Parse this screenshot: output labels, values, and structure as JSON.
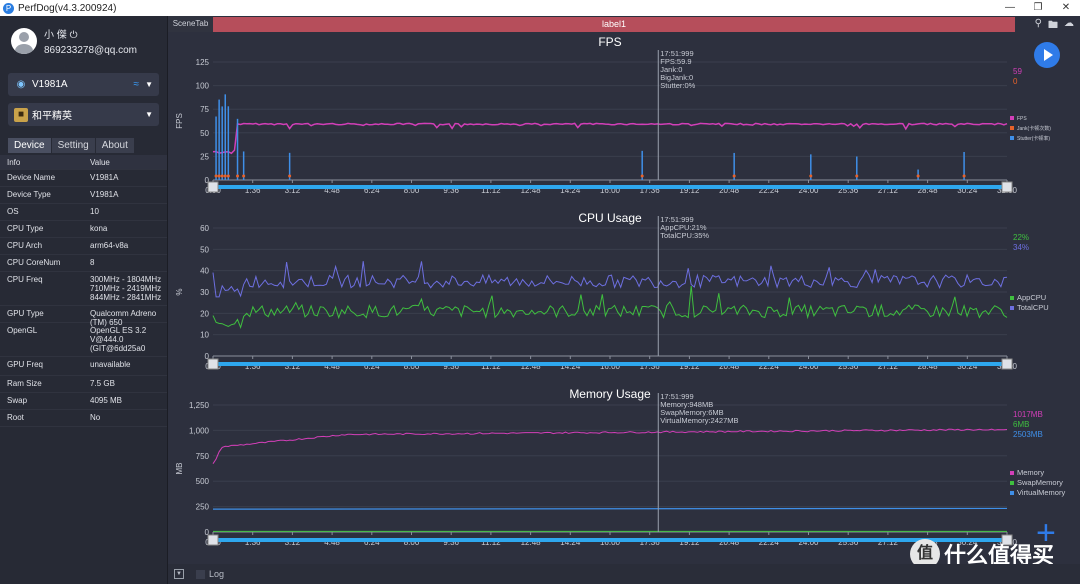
{
  "window": {
    "title": "PerfDog(v4.3.200924)",
    "controls": [
      "minimize",
      "restore",
      "close"
    ]
  },
  "profile": {
    "username": "小 傑",
    "email": "869233278@qq.com"
  },
  "device_selector": {
    "value": "V1981A",
    "icon": "android-icon",
    "connection_icon": "wifi-icon"
  },
  "app_selector": {
    "value": "和平精英"
  },
  "sidebar_tabs": [
    {
      "label": "Device",
      "active": true
    },
    {
      "label": "Setting",
      "active": false
    },
    {
      "label": "About",
      "active": false
    }
  ],
  "device_info": {
    "headers": [
      "Info",
      "Value"
    ],
    "rows": [
      {
        "key": "Device Name",
        "value": "V1981A"
      },
      {
        "key": "Device Type",
        "value": "V1981A"
      },
      {
        "key": "OS",
        "value": "10"
      },
      {
        "key": "CPU Type",
        "value": "kona"
      },
      {
        "key": "CPU Arch",
        "value": "arm64-v8a"
      },
      {
        "key": "CPU CoreNum",
        "value": "8"
      },
      {
        "key": "CPU Freq",
        "value": "300MHz - 1804MHz\n710MHz - 2419MHz\n844MHz - 2841MHz"
      },
      {
        "key": "GPU Type",
        "value": "Qualcomm Adreno (TM) 650"
      },
      {
        "key": "OpenGL",
        "value": "OpenGL ES 3.2 V@444.0 (GIT@6dd25a0"
      },
      {
        "key": "GPU Freq",
        "value": "unavailable"
      },
      {
        "key": "Ram Size",
        "value": "7.5 GB"
      },
      {
        "key": "Swap",
        "value": "4095 MB"
      },
      {
        "key": "Root",
        "value": "No"
      }
    ]
  },
  "top_bar": {
    "scene_tab": "SceneTab",
    "label": "label1",
    "icons": [
      "location-icon",
      "folder-icon",
      "cloud-icon"
    ]
  },
  "log_bar": {
    "label": "Log"
  },
  "watermark": {
    "text": "什么值得买"
  },
  "chart_data": [
    {
      "type": "line",
      "title": "FPS",
      "ylabel": "FPS",
      "ylim": [
        0,
        125
      ],
      "yticks": [
        0,
        25,
        50,
        75,
        100,
        125
      ],
      "xticks": [
        "0:00",
        "1:36",
        "3:12",
        "4:48",
        "6:24",
        "8:00",
        "9:36",
        "11:12",
        "12:48",
        "14:24",
        "16:00",
        "17:36",
        "19:12",
        "20:48",
        "22:24",
        "24:00",
        "25:36",
        "27:12",
        "28:48",
        "30:24",
        "31:50"
      ],
      "cursor": {
        "time": "17:51:999",
        "lines": [
          "17:51:999",
          "FPS:59.9",
          "Jank:0",
          "BigJank:0",
          "Stutter:0%"
        ]
      },
      "current_values": [
        {
          "value": "59",
          "color": "#d23fb8"
        },
        {
          "value": "0",
          "color": "#e8622a"
        }
      ],
      "series": [
        {
          "name": "FPS",
          "color": "#d23fb8",
          "steady": 60,
          "early": 30
        },
        {
          "name": "Jank(卡顿次数)",
          "color": "#e8622a"
        },
        {
          "name": "Stutter(卡顿率)",
          "color": "#3f8fe8"
        }
      ]
    },
    {
      "type": "line",
      "title": "CPU Usage",
      "ylabel": "%",
      "ylim": [
        0,
        60
      ],
      "yticks": [
        0,
        10,
        20,
        30,
        40,
        50,
        60
      ],
      "xticks": [
        "0:00",
        "1:36",
        "3:12",
        "4:48",
        "6:24",
        "8:00",
        "9:36",
        "11:12",
        "12:48",
        "14:24",
        "16:00",
        "17:36",
        "19:12",
        "20:48",
        "22:24",
        "24:00",
        "25:36",
        "27:12",
        "28:48",
        "30:24",
        "31:50"
      ],
      "cursor": {
        "time": "17:51:999",
        "lines": [
          "17:51:999",
          "AppCPU:21%",
          "TotalCPU:35%"
        ]
      },
      "current_values": [
        {
          "value": "22%",
          "color": "#3fbf3f"
        },
        {
          "value": "34%",
          "color": "#6d6fe0"
        }
      ],
      "series": [
        {
          "name": "AppCPU",
          "color": "#3fbf3f",
          "mean": 21
        },
        {
          "name": "TotalCPU",
          "color": "#6d6fe0",
          "mean": 35
        }
      ]
    },
    {
      "type": "line",
      "title": "Memory Usage",
      "ylabel": "MB",
      "ylim": [
        0,
        1250
      ],
      "yticks": [
        "0",
        "250",
        "500",
        "750",
        "1,000",
        "1,250"
      ],
      "xticks": [
        "0:00",
        "1:36",
        "3:12",
        "4:48",
        "6:24",
        "8:00",
        "9:36",
        "11:12",
        "12:48",
        "14:24",
        "16:00",
        "17:36",
        "19:12",
        "20:48",
        "22:24",
        "24:00",
        "25:36",
        "27:12",
        "28:48",
        "30:24",
        "31:50"
      ],
      "cursor": {
        "time": "17:51:999",
        "lines": [
          "17:51:999",
          "Memory:948MB",
          "SwapMemory:6MB",
          "VirtualMemory:2427MB"
        ]
      },
      "current_values": [
        {
          "value": "1017MB",
          "color": "#d23fb8"
        },
        {
          "value": "6MB",
          "color": "#3fbf3f"
        },
        {
          "value": "2503MB",
          "color": "#3f8fe8"
        }
      ],
      "series": [
        {
          "name": "Memory",
          "color": "#d23fb8",
          "start": 650,
          "end": 1017
        },
        {
          "name": "SwapMemory",
          "color": "#3fbf3f",
          "value": 6
        },
        {
          "name": "VirtualMemory",
          "color": "#3f8fe8",
          "value": 2427
        }
      ]
    }
  ]
}
